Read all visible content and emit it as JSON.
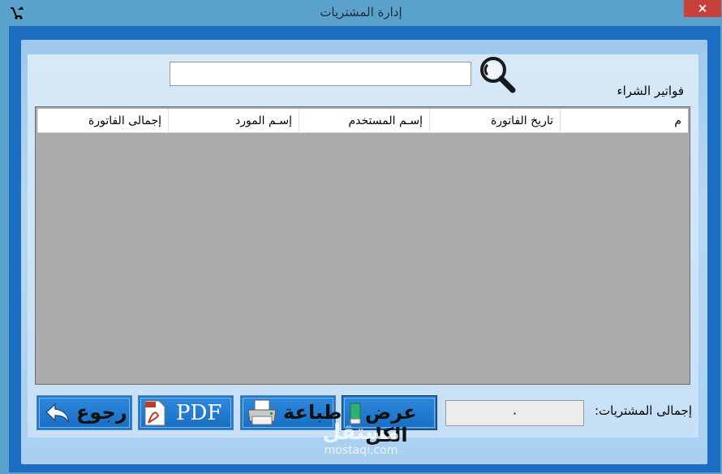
{
  "window": {
    "title": "إدارة المشتريات",
    "close_label": "×"
  },
  "search": {
    "value": "",
    "placeholder": ""
  },
  "section_title": "فواتير الشراء",
  "table": {
    "columns": [
      "م",
      "تاريخ الفاتورة",
      "إسـم المستخدم",
      "إسـم المورد",
      "إجمالى الفاتورة"
    ],
    "rows": []
  },
  "footer": {
    "total_label": "إجمالى المشتريات:",
    "total_value": "٠"
  },
  "buttons": {
    "show_all": "عرض الكل",
    "print": "طباعة",
    "pdf": "PDF",
    "back": "رجوع"
  },
  "watermark": {
    "arabic": "مستقل",
    "latin": "mostaqi.com"
  },
  "colors": {
    "title_bar": "#5aa2cc",
    "client_bg": "#1c6ec3",
    "panel": "#d6e9f8",
    "grid": "#ababab",
    "close": "#c6413b"
  }
}
